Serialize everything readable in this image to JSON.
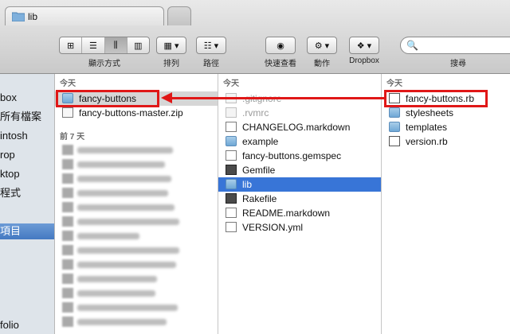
{
  "window": {
    "tab_title": "lib"
  },
  "toolbar": {
    "view_label": "顯示方式",
    "arrange_label": "排列",
    "path_label": "路徑",
    "quicklook_label": "快速查看",
    "action_label": "動作",
    "dropbox_label": "Dropbox",
    "search_label": "搜尋",
    "search_placeholder": ""
  },
  "sidebar": {
    "items": [
      {
        "label": "box"
      },
      {
        "label": "所有檔案"
      },
      {
        "label": "intosh"
      },
      {
        "label": "rop"
      },
      {
        "label": "ktop"
      },
      {
        "label": "程式"
      },
      {
        "label": "項目",
        "selected": true
      },
      {
        "label": "folio"
      }
    ]
  },
  "column1": {
    "section_today": "今天",
    "items": [
      {
        "name": "fancy-buttons",
        "icon": "folder-icon"
      },
      {
        "name": "fancy-buttons-master.zip",
        "icon": "zip-icon"
      }
    ],
    "section_7days": "前 7 天"
  },
  "column2": {
    "section_today": "今天",
    "items": [
      {
        "name": ".gitignore",
        "icon": "document-icon",
        "dim": true
      },
      {
        "name": ".rvmrc",
        "icon": "document-icon",
        "dim": true
      },
      {
        "name": "CHANGELOG.markdown",
        "icon": "document-icon"
      },
      {
        "name": "example",
        "icon": "folder-icon"
      },
      {
        "name": "fancy-buttons.gemspec",
        "icon": "document-icon"
      },
      {
        "name": "Gemfile",
        "icon": "gemfile-icon"
      },
      {
        "name": "lib",
        "icon": "folder-icon",
        "selected": true
      },
      {
        "name": "Rakefile",
        "icon": "gemfile-icon"
      },
      {
        "name": "README.markdown",
        "icon": "document-icon"
      },
      {
        "name": "VERSION.yml",
        "icon": "document-icon"
      }
    ]
  },
  "column3": {
    "section_today": "今天",
    "items": [
      {
        "name": "fancy-buttons.rb",
        "icon": "ruby-file-icon"
      },
      {
        "name": "stylesheets",
        "icon": "folder-icon"
      },
      {
        "name": "templates",
        "icon": "folder-icon"
      },
      {
        "name": "version.rb",
        "icon": "ruby-file-icon"
      }
    ]
  },
  "colors": {
    "annotation": "#e01717",
    "selection": "#3875d7",
    "sidebar_selection": "#4479c2"
  }
}
